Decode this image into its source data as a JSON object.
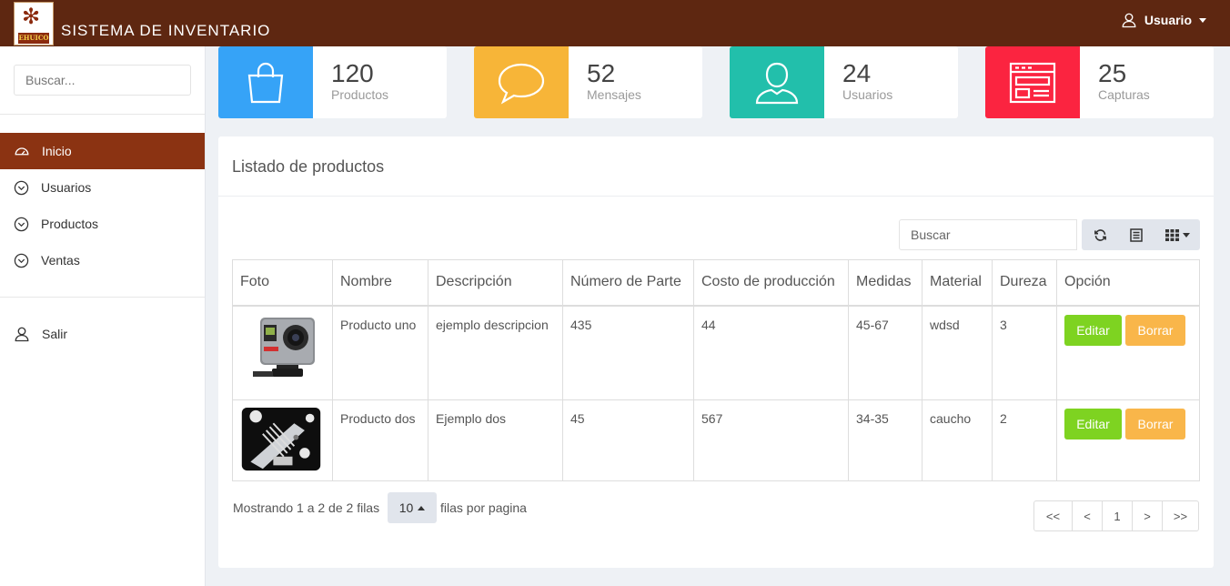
{
  "header": {
    "logo_text": "EHUICO",
    "app_title": "SISTEMA DE INVENTARIO",
    "user_label": "Usuario"
  },
  "sidebar": {
    "search_placeholder": "Buscar...",
    "items": [
      {
        "label": "Inicio",
        "icon": "dashboard-icon",
        "active": true
      },
      {
        "label": "Usuarios",
        "icon": "chevron-circle-icon"
      },
      {
        "label": "Productos",
        "icon": "chevron-circle-icon"
      },
      {
        "label": "Ventas",
        "icon": "chevron-circle-icon"
      }
    ],
    "logout_label": "Salir"
  },
  "stats": [
    {
      "value": "120",
      "label": "Productos",
      "color": "#36a3f7",
      "icon": "shopping-bag-icon"
    },
    {
      "value": "52",
      "label": "Mensajes",
      "color": "#f7b538",
      "icon": "chat-bubble-icon"
    },
    {
      "value": "24",
      "label": "Usuarios",
      "color": "#22bfab",
      "icon": "user-icon"
    },
    {
      "value": "25",
      "label": "Capturas",
      "color": "#fb2440",
      "icon": "browser-window-icon"
    }
  ],
  "panel": {
    "title": "Listado de productos",
    "search_placeholder": "Buscar",
    "columns": [
      "Foto",
      "Nombre",
      "Descripción",
      "Número de Parte",
      "Costo de producción",
      "Medidas",
      "Material",
      "Dureza",
      "Opción"
    ],
    "rows": [
      {
        "photo": "action-camera-photo",
        "name": "Producto uno",
        "description": "ejemplo descripcion",
        "part_number": "435",
        "cost": "44",
        "size": "45-67",
        "material": "wdsd",
        "hardness": "3",
        "edit": "Editar",
        "delete": "Borrar"
      },
      {
        "photo": "guitar-bridge-photo",
        "name": "Producto dos",
        "description": "Ejemplo dos",
        "part_number": "45",
        "cost": "567",
        "size": "34-35",
        "material": "caucho",
        "hardness": "2",
        "edit": "Editar",
        "delete": "Borrar"
      }
    ],
    "footer": {
      "showing": "Mostrando 1 a 2 de 2 filas",
      "page_size": "10",
      "per_page": "filas por pagina"
    },
    "pager": [
      "<<",
      "<",
      "1",
      ">",
      ">>"
    ]
  },
  "colors": {
    "topbar": "#5e2711",
    "active_nav": "#8b3312",
    "edit_button": "#7ed321",
    "delete_button": "#f9b64a"
  }
}
